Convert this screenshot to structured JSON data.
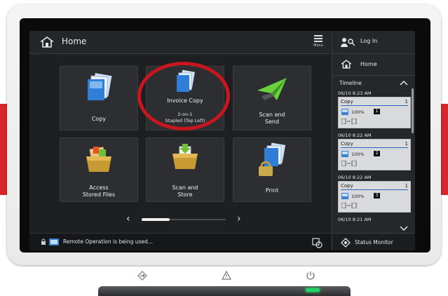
{
  "header": {
    "title": "Home",
    "menu_label": "Menu"
  },
  "tiles": [
    {
      "label": "Copy",
      "sub": ""
    },
    {
      "label": "Invoice Copy",
      "sub_line1": "2-on-1",
      "sub_line2": "Stapled (Top Left)"
    },
    {
      "label_line1": "Scan and",
      "label_line2": "Send"
    },
    {
      "label_line1": "Access",
      "label_line2": "Stored Files"
    },
    {
      "label_line1": "Scan and",
      "label_line2": "Store"
    },
    {
      "label": "Print"
    }
  ],
  "status_bar": {
    "text": "Remote Operation is being used..."
  },
  "panel": {
    "login_label": "Log In",
    "home_label": "Home",
    "timeline_label": "Timeline",
    "jobs": [
      {
        "time": "06/10 8:23 AM",
        "type": "Copy",
        "count": "1",
        "percent": "100%",
        "number": "1"
      },
      {
        "time": "06/10 8:22 AM",
        "type": "Copy",
        "count": "1",
        "percent": "100%",
        "number": "2"
      },
      {
        "time": "06/10 8:22 AM",
        "type": "Copy",
        "count": "1",
        "percent": "100%",
        "number": "3"
      },
      {
        "time": "06/10 8:21 AM"
      }
    ],
    "status_monitor_label": "Status Monitor"
  },
  "colors": {
    "accent_blue": "#2c63c7",
    "annotation_red": "#c8161e",
    "led_green": "#22d36a"
  }
}
